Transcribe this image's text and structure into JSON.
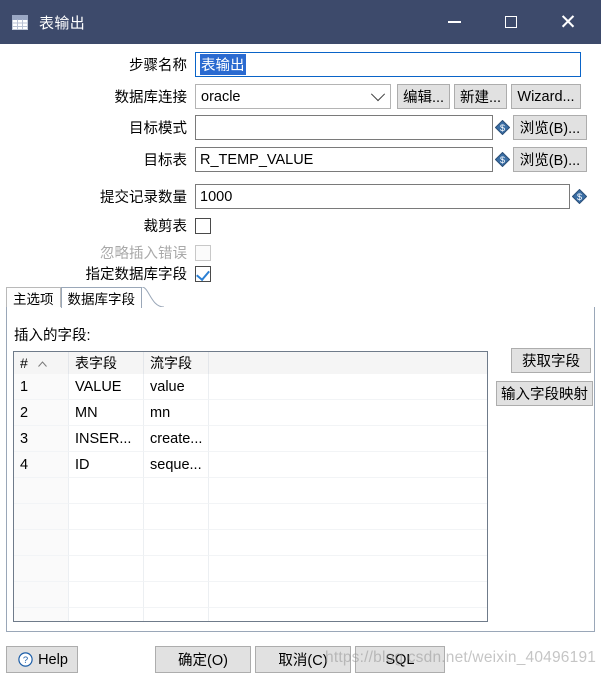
{
  "window": {
    "title": "表输出",
    "title_icon": "table-icon",
    "controls": {
      "minimize": "minimize-icon",
      "maximize": "maximize-icon",
      "close": "close-icon"
    },
    "titlebar_color": "#3d4a6b"
  },
  "form": {
    "step_name": {
      "label": "步骤名称",
      "value": "表输出",
      "selected": true
    },
    "connection": {
      "label": "数据库连接",
      "value": "oracle",
      "edit_label": "编辑...",
      "new_label": "新建...",
      "wizard_label": "Wizard..."
    },
    "target_schema": {
      "label": "目标模式",
      "value": "",
      "browse_label": "浏览(B)..."
    },
    "target_table": {
      "label": "目标表",
      "value": "R_TEMP_VALUE",
      "browse_label": "浏览(B)..."
    },
    "commit_size": {
      "label": "提交记录数量",
      "value": "1000"
    },
    "truncate_table": {
      "label": "裁剪表",
      "checked": false
    },
    "ignore_insert_errors": {
      "label": "忽略插入错误",
      "checked": false,
      "disabled": true
    },
    "specify_db_fields": {
      "label": "指定数据库字段",
      "checked": true
    }
  },
  "tabs": [
    {
      "label": "主选项",
      "active": false
    },
    {
      "label": "数据库字段",
      "active": true
    }
  ],
  "fields_panel": {
    "section_label": "插入的字段:",
    "columns": [
      "#",
      "表字段",
      "流字段",
      ""
    ],
    "rows": [
      {
        "index": "1",
        "table_field": "VALUE",
        "stream_field": "value",
        "extra": ""
      },
      {
        "index": "2",
        "table_field": "MN",
        "stream_field": "mn",
        "extra": ""
      },
      {
        "index": "3",
        "table_field": "INSER...",
        "stream_field": "create...",
        "extra": ""
      },
      {
        "index": "4",
        "table_field": "ID",
        "stream_field": "seque...",
        "extra": ""
      }
    ],
    "empty_rows": 6,
    "get_fields_label": "获取字段",
    "input_mapping_label": "输入字段映射"
  },
  "footer": {
    "help_label": "Help",
    "ok_label": "确定(O)",
    "cancel_label": "取消(C)",
    "sql_label": "SQL"
  },
  "watermark": "https://blog.csdn.net/weixin_40496191"
}
